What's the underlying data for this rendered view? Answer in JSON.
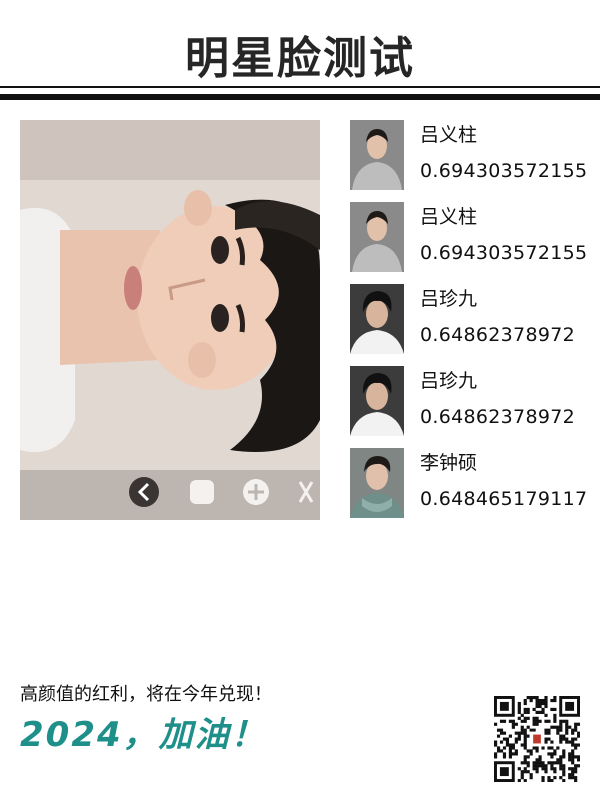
{
  "title": "明星脸测试",
  "matches": [
    {
      "name": "吕义柱",
      "score": "0.694303572155",
      "thumb_icon": "celebrity-photo-gray-sweater"
    },
    {
      "name": "吕义柱",
      "score": "0.694303572155",
      "thumb_icon": "celebrity-photo-gray-sweater"
    },
    {
      "name": "吕珍九",
      "score": "0.64862378972",
      "thumb_icon": "celebrity-photo-white-shirt"
    },
    {
      "name": "吕珍九",
      "score": "0.64862378972",
      "thumb_icon": "celebrity-photo-white-shirt"
    },
    {
      "name": "李钟硕",
      "score": "0.648465179117",
      "thumb_icon": "celebrity-photo-scarf"
    }
  ],
  "footer": {
    "line1": "高颜值的红利，将在今年兑现！",
    "line2": "2024，加油！"
  },
  "colors": {
    "accent": "#1f8f8a",
    "text": "#111111",
    "rule": "#111111"
  }
}
